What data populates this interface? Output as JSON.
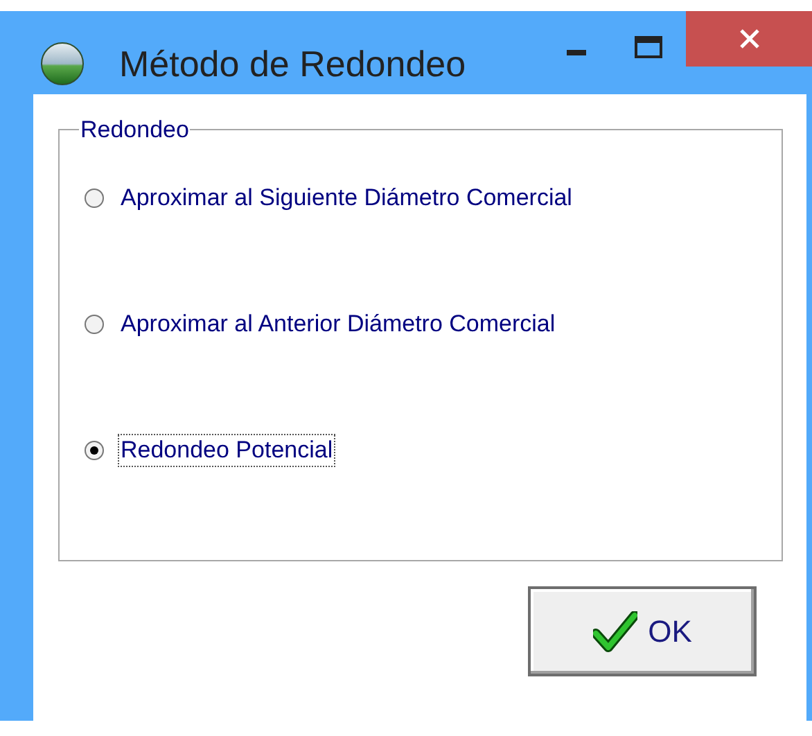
{
  "window": {
    "title": "Método de Redondeo"
  },
  "group": {
    "title": "Redondeo",
    "options": [
      {
        "label": "Aproximar al Siguiente Diámetro Comercial",
        "selected": false,
        "focused": false
      },
      {
        "label": "Aproximar al Anterior Diámetro Comercial",
        "selected": false,
        "focused": false
      },
      {
        "label": "Redondeo Potencial",
        "selected": true,
        "focused": true
      }
    ]
  },
  "button": {
    "label": "OK"
  }
}
